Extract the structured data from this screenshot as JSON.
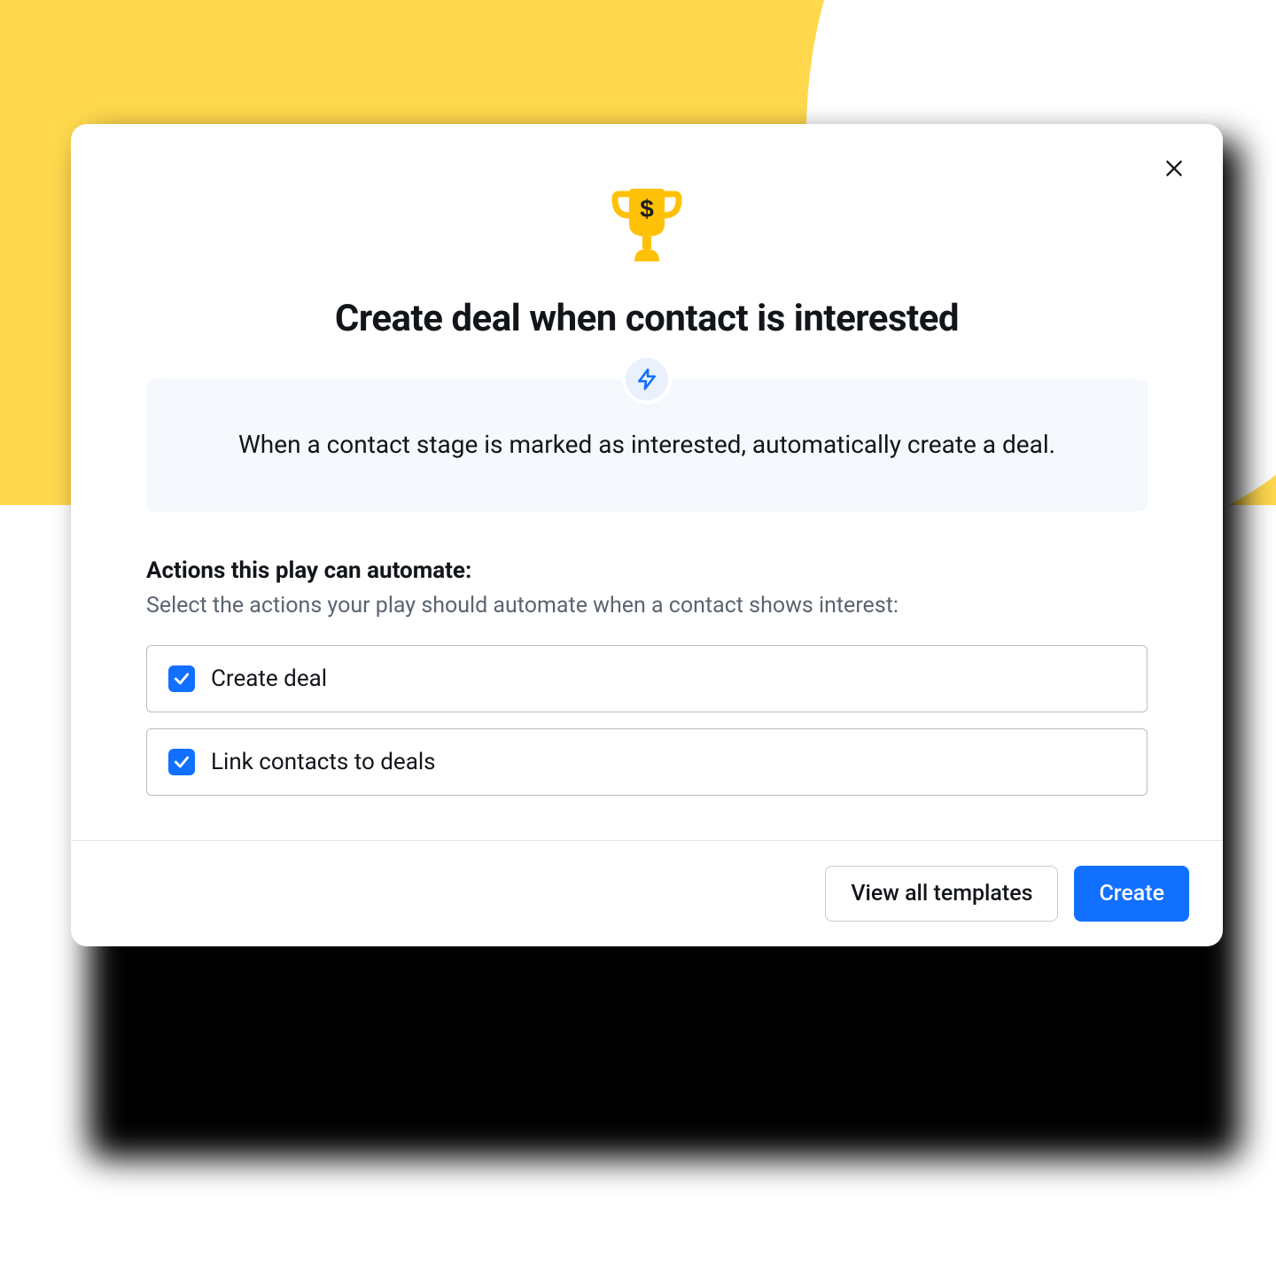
{
  "modal": {
    "title": "Create deal when contact is interested",
    "info_text": "When a contact stage is marked as interested, automatically create a deal.",
    "section_heading": "Actions this play can automate:",
    "section_sub": "Select the actions your play should automate when a contact shows interest:",
    "actions": [
      {
        "label": "Create deal",
        "checked": true
      },
      {
        "label": "Link contacts to deals",
        "checked": true
      }
    ],
    "footer": {
      "view_templates": "View all templates",
      "create": "Create"
    }
  },
  "colors": {
    "accent_yellow": "#ffd84d",
    "primary_blue": "#1170ff",
    "info_bg": "#f5f8fc"
  }
}
